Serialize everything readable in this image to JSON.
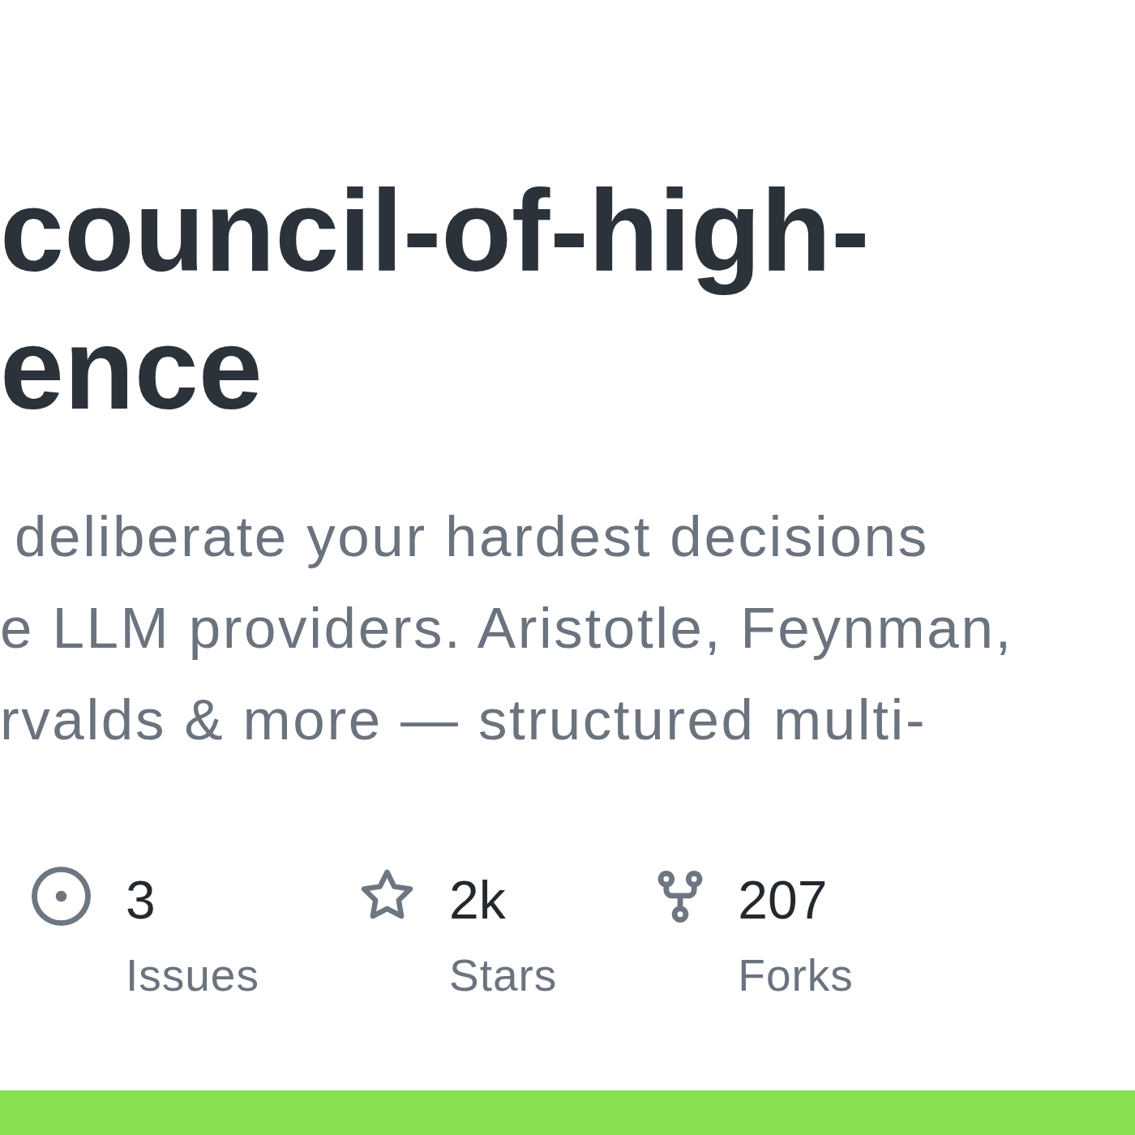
{
  "repository": {
    "title_lines": [
      "council-of-high-",
      "ence"
    ],
    "description_lines": [
      "deliberate your hardest decisions",
      "e LLM providers. Aristotle, Feynman,",
      "rvalds & more — structured multi-"
    ]
  },
  "stats": [
    {
      "kind": "issues",
      "count": "3",
      "label": "Issues"
    },
    {
      "kind": "stars",
      "count": "2k",
      "label": "Stars"
    },
    {
      "kind": "forks",
      "count": "207",
      "label": "Forks"
    }
  ],
  "language_bar": {
    "segments": [
      {
        "color": "#89e051",
        "level": 1
      }
    ]
  }
}
